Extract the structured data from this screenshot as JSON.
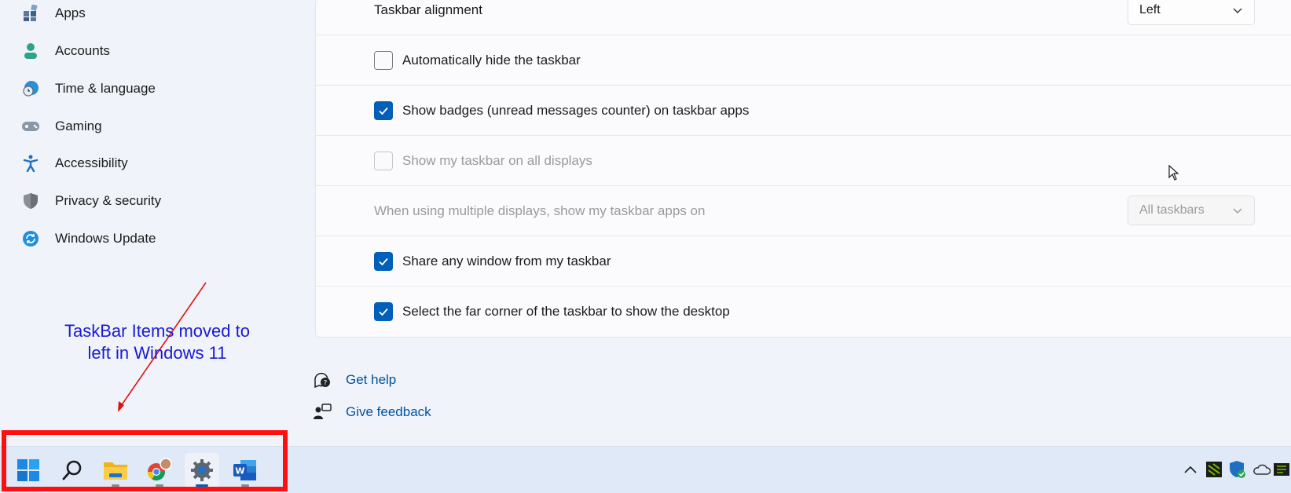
{
  "sidebar": {
    "items": [
      {
        "label": "Apps",
        "icon": "apps-icon"
      },
      {
        "label": "Accounts",
        "icon": "accounts-icon"
      },
      {
        "label": "Time & language",
        "icon": "time-language-icon"
      },
      {
        "label": "Gaming",
        "icon": "gaming-icon"
      },
      {
        "label": "Accessibility",
        "icon": "accessibility-icon"
      },
      {
        "label": "Privacy & security",
        "icon": "shield-icon"
      },
      {
        "label": "Windows Update",
        "icon": "windows-update-icon"
      }
    ]
  },
  "settings": {
    "alignment_label": "Taskbar alignment",
    "alignment_value": "Left",
    "auto_hide": "Automatically hide the taskbar",
    "badges": "Show badges (unread messages counter) on taskbar apps",
    "all_displays": "Show my taskbar on all displays",
    "multi_display_label": "When using multiple displays, show my taskbar apps on",
    "multi_display_value": "All taskbars",
    "share_window": "Share any window from my taskbar",
    "far_corner": "Select the far corner of the taskbar to show the desktop"
  },
  "states": {
    "auto_hide": false,
    "badges": true,
    "all_displays": false,
    "share_window": true,
    "far_corner": true
  },
  "links": {
    "get_help": "Get help",
    "give_feedback": "Give feedback"
  },
  "annotation": {
    "line1": "TaskBar Items moved to",
    "line2": "left in Windows 11"
  },
  "taskbar": {
    "icons": [
      "start-icon",
      "search-icon",
      "file-explorer-icon",
      "chrome-icon",
      "settings-icon",
      "word-icon"
    ],
    "tray": [
      "chevron-up-icon",
      "nvidia-icon",
      "defender-icon",
      "onedrive-icon",
      "gpu-icon"
    ]
  },
  "colors": {
    "accent": "#005fb8",
    "link": "#00539c",
    "annotation": "#1a1ad6",
    "highlight_box": "#ff1010"
  }
}
